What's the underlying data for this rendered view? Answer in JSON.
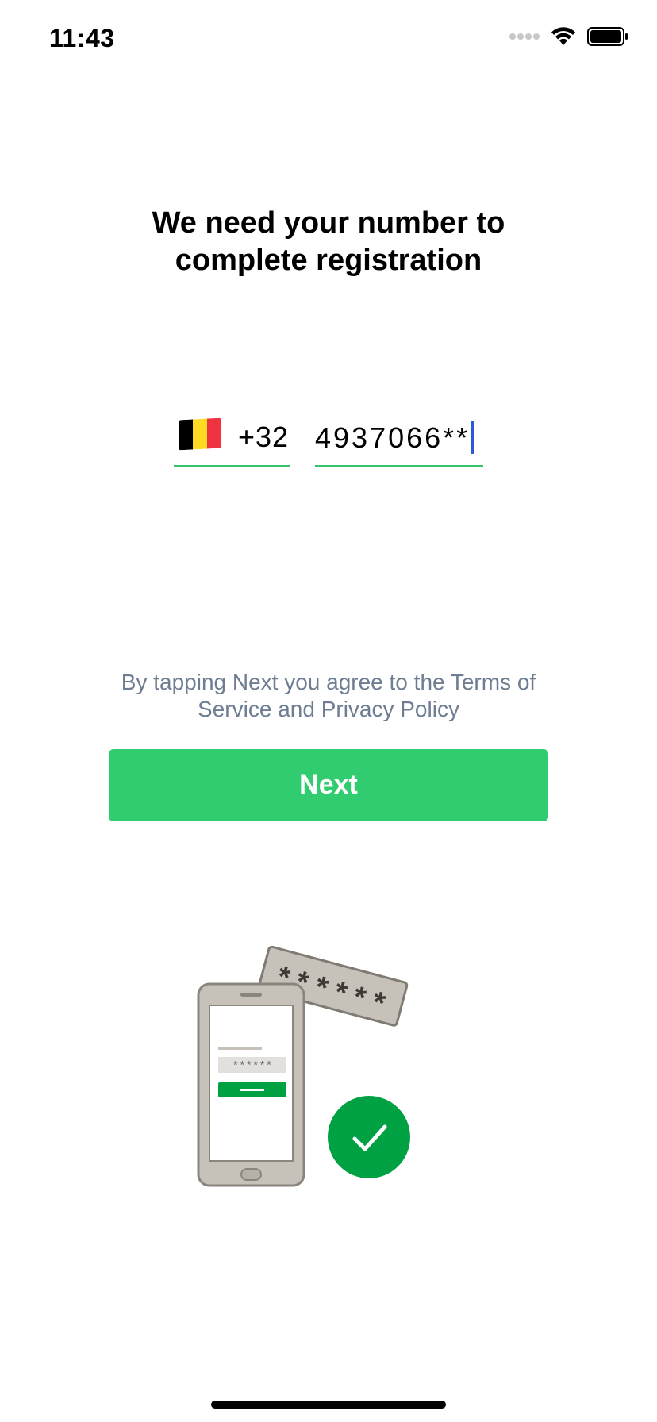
{
  "status_bar": {
    "time": "11:43",
    "signal_icon": "signal-dots-icon",
    "wifi_icon": "wifi-icon",
    "battery_icon": "battery-icon"
  },
  "heading": {
    "line1": "We need your number to",
    "line2": "complete registration"
  },
  "phone": {
    "country_flag": "belgium-flag-icon",
    "country_code": "+32",
    "number_value": "4937066**",
    "flag_colors": [
      "#000000",
      "#fdda24",
      "#ef3340"
    ],
    "underline_color": "#34c46a",
    "caret_color": "#2d5bd6"
  },
  "terms": {
    "line1": "By tapping Next you agree to the Terms of",
    "line2": "Service and Privacy Policy",
    "color": "#6e7d91"
  },
  "next_button": {
    "label": "Next",
    "color": "#31cc6f"
  },
  "illustration": {
    "code_card_text": "******",
    "screen_code_text": "******",
    "check_icon": "checkmark-icon",
    "accent": "#00a143"
  }
}
